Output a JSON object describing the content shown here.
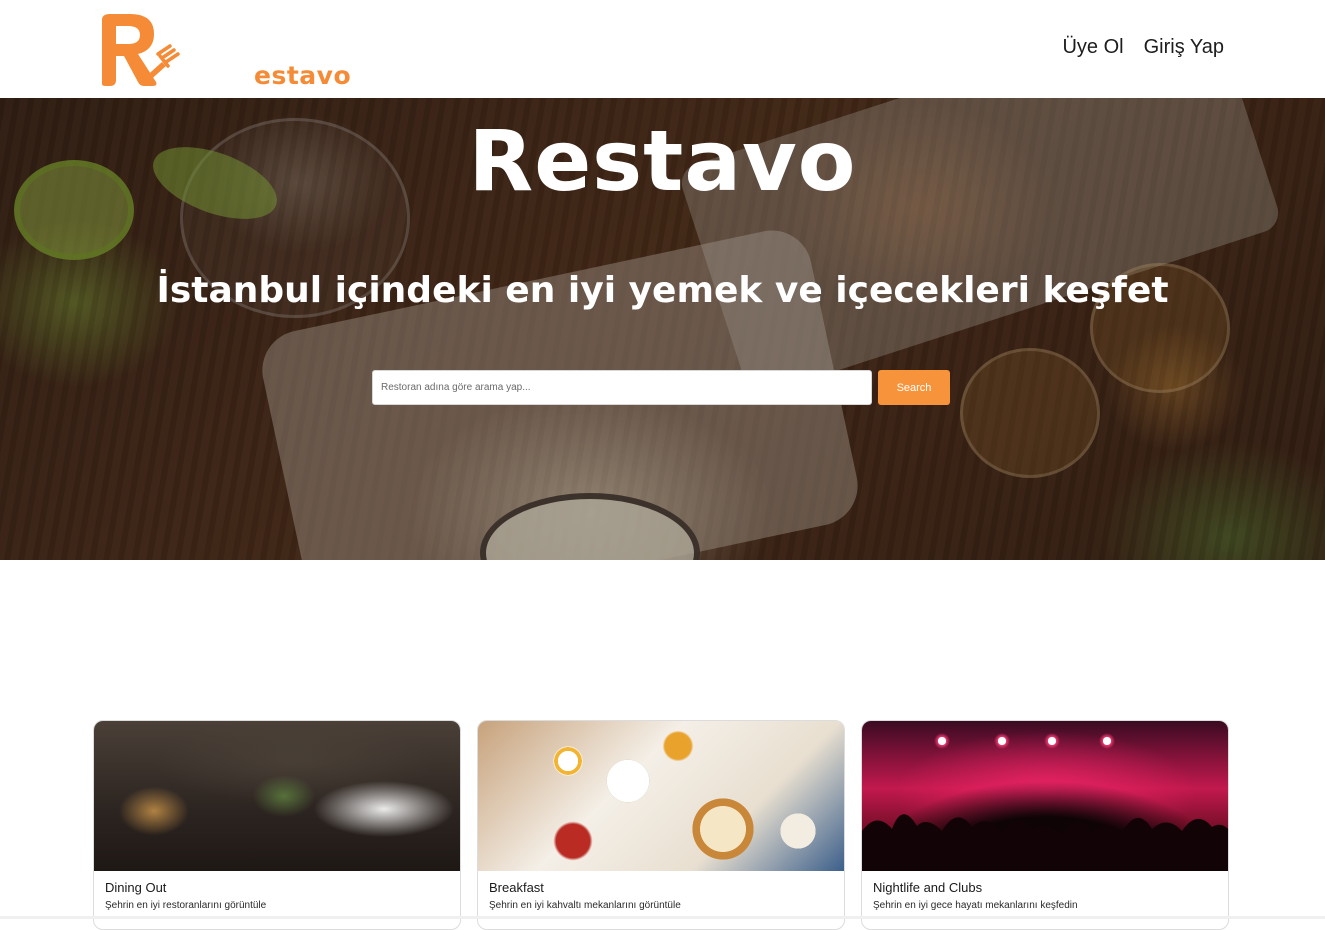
{
  "header": {
    "logo_text": "estavo",
    "logo_alt": "Restavo",
    "nav": [
      {
        "label": "Üye Ol"
      },
      {
        "label": "Giriş Yap"
      }
    ]
  },
  "hero": {
    "title": "Restavo",
    "subtitle": "İstanbul içindeki en iyi yemek ve içecekleri keşfet",
    "search": {
      "placeholder": "Restoran adına göre arama yap...",
      "value": "",
      "button_label": "Search"
    }
  },
  "cards": [
    {
      "title": "Dining Out",
      "description": "Şehrin en iyi restoranlarını görüntüle"
    },
    {
      "title": "Breakfast",
      "description": "Şehrin en iyi kahvaltı mekanlarını görüntüle"
    },
    {
      "title": "Nightlife and Clubs",
      "description": "Şehrin en iyi gece hayatı mekanlarını keşfedin"
    }
  ],
  "colors": {
    "brand_orange": "#f58b36",
    "button_orange": "#f7933a",
    "text_dark": "#1d1d1d"
  }
}
